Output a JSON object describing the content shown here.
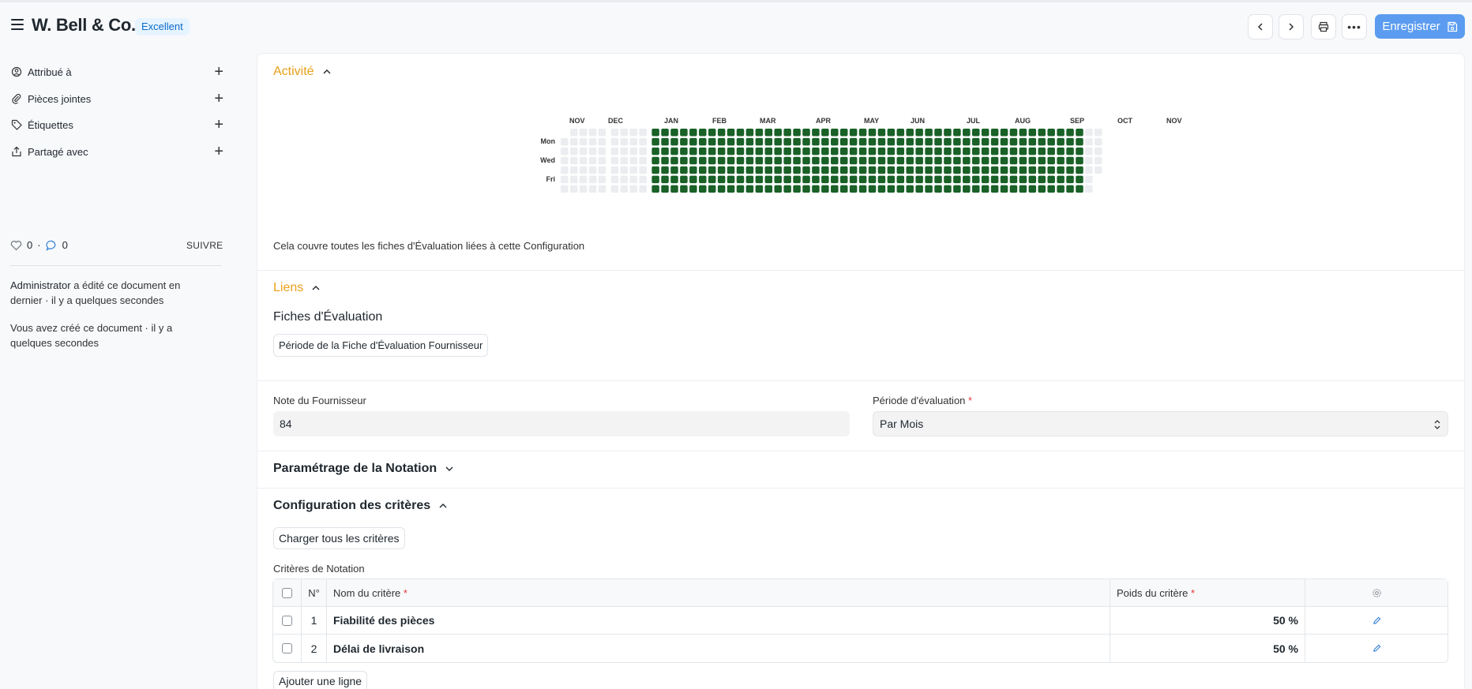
{
  "header": {
    "title": "W. Bell & Co.",
    "badge": "Excellent",
    "save_label": "Enregistrer"
  },
  "sidebar": {
    "items": [
      {
        "label": "Attribué à",
        "icon": "assign-icon"
      },
      {
        "label": "Pièces jointes",
        "icon": "paperclip-icon"
      },
      {
        "label": "Étiquettes",
        "icon": "tag-icon"
      },
      {
        "label": "Partagé avec",
        "icon": "share-icon"
      }
    ],
    "likes": "0",
    "comments": "0",
    "follow_label": "SUIVRE",
    "activity_user": "Administrator",
    "activity_edit": "a édité ce document en dernier · il y a quelques secondes",
    "activity_create": "Vous avez créé ce document · il y a quelques secondes"
  },
  "activity": {
    "title": "Activité",
    "months": [
      "NOV",
      "DEC",
      "JAN",
      "FEB",
      "MAR",
      "APR",
      "MAY",
      "JUN",
      "JUL",
      "AUG",
      "SEP",
      "OCT",
      "NOV"
    ],
    "days": [
      "Mon",
      "Wed",
      "Fri"
    ],
    "note": "Cela couvre toutes les fiches d'Évaluation liées à cette Configuration",
    "colors": {
      "active": "#196127",
      "empty": "#ebedf0"
    }
  },
  "links": {
    "title": "Liens",
    "group": "Fiches d'Évaluation",
    "button": "Période de la Fiche d'Évaluation Fournisseur"
  },
  "fields": {
    "score_label": "Note du Fournisseur",
    "score_value": "84",
    "period_label": "Période d'évaluation",
    "period_value": "Par Mois"
  },
  "rating_setup": {
    "title": "Paramétrage de la Notation"
  },
  "criteria": {
    "title": "Configuration des critères",
    "load_button": "Charger tous les critères",
    "table_label": "Critères de Notation",
    "columns": {
      "no": "N°",
      "name": "Nom du critère",
      "weight": "Poids du critère"
    },
    "rows": [
      {
        "no": "1",
        "name": "Fiabilité des pièces",
        "weight": "50 %"
      },
      {
        "no": "2",
        "name": "Délai de livraison",
        "weight": "50 %"
      }
    ],
    "add_row": "Ajouter une ligne"
  }
}
